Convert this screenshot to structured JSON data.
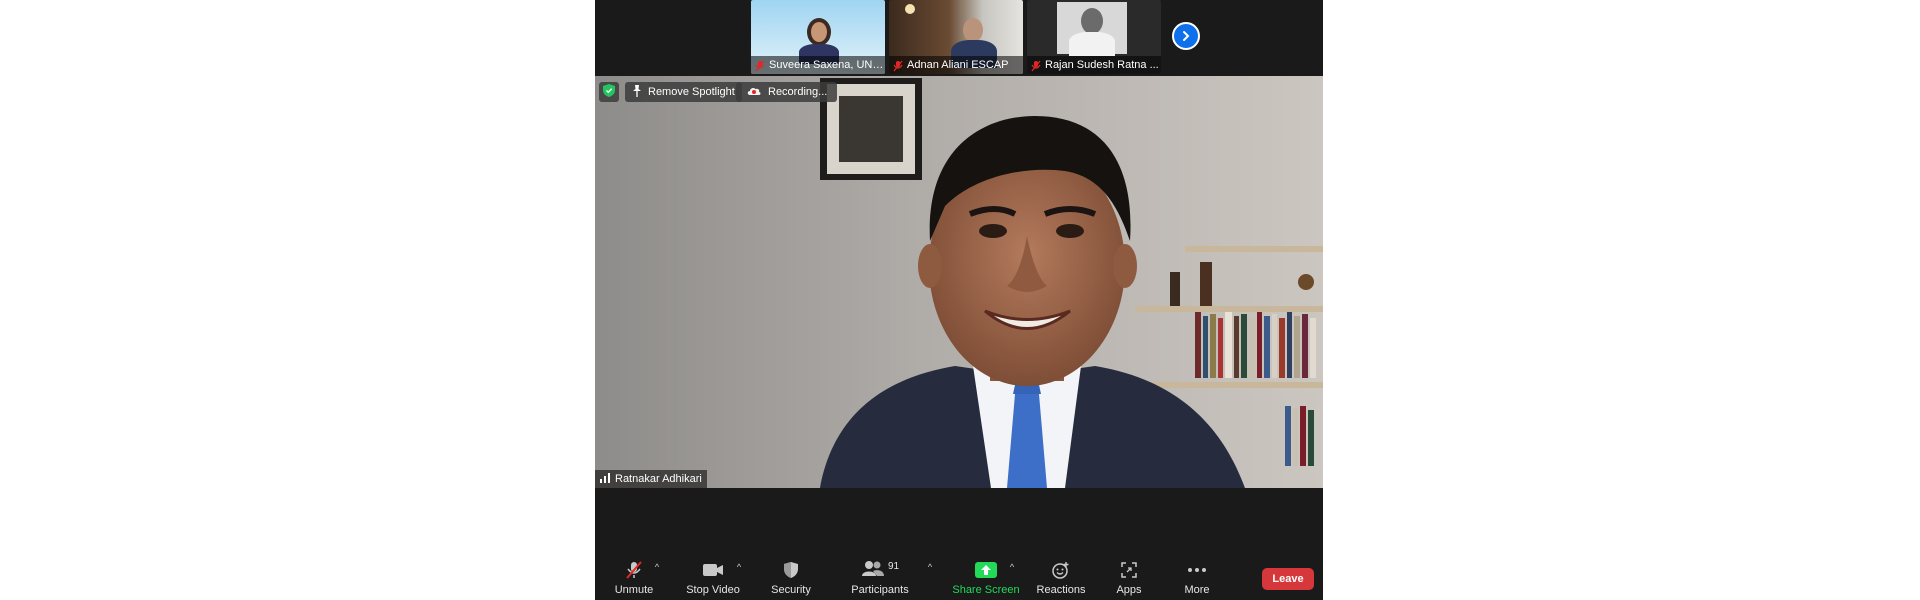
{
  "thumbnails": [
    {
      "name": "Suveera Saxena, UNE..."
    },
    {
      "name": "Adnan Aliani ESCAP"
    },
    {
      "name": "Rajan Sudesh Ratna ..."
    }
  ],
  "spotlight": {
    "remove_label": "Remove Spotlight",
    "recording_label": "Recording..."
  },
  "speaker": {
    "name": "Ratnakar Adhikari"
  },
  "toolbar": {
    "unmute": "Unmute",
    "stop_video": "Stop Video",
    "security": "Security",
    "participants": "Participants",
    "participants_count": "91",
    "share_screen": "Share Screen",
    "reactions": "Reactions",
    "apps": "Apps",
    "more": "More",
    "leave": "Leave"
  },
  "colors": {
    "share_green": "#23d959",
    "leave_red": "#d6373b",
    "accent_blue": "#0e71eb",
    "shield_green": "#22c55e"
  }
}
